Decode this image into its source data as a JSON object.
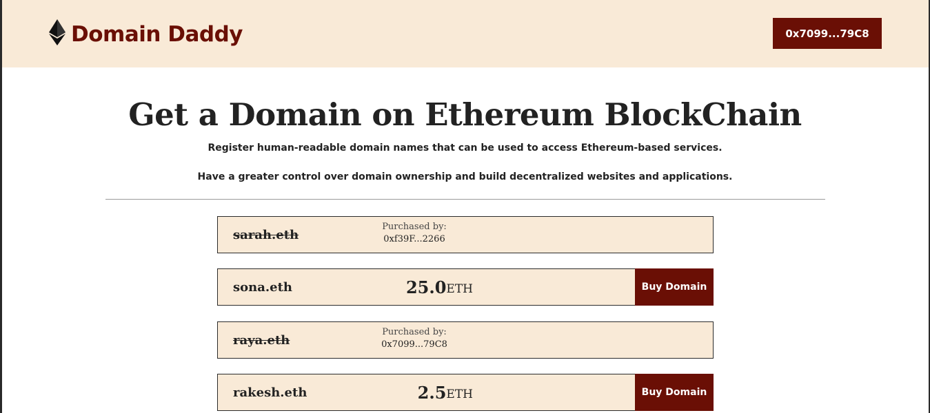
{
  "header": {
    "logo_text": "Domain Daddy",
    "logo_icon": "ethereum-icon",
    "wallet_address": "0x7099...79C8"
  },
  "hero": {
    "title": "Get a Domain on Ethereum BlockChain",
    "subtitle_1": "Register human-readable domain names that can be used to access Ethereum-based services.",
    "subtitle_2": "Have a greater control over domain ownership and build decentralized websites and applications."
  },
  "domains": [
    {
      "name": "sarah.eth",
      "status": "sold",
      "owner_label": "Purchased by:",
      "owner": "0xf39F...2266"
    },
    {
      "name": "sona.eth",
      "status": "available",
      "price": "25.0",
      "unit": "ETH",
      "buy_label": "Buy Domain"
    },
    {
      "name": "raya.eth",
      "status": "sold",
      "owner_label": "Purchased by:",
      "owner": "0x7099...79C8"
    },
    {
      "name": "rakesh.eth",
      "status": "available",
      "price": "2.5",
      "unit": "ETH",
      "buy_label": "Buy Domain"
    }
  ],
  "colors": {
    "brand": "#6a0f05",
    "header_bg": "#f9ead7",
    "card_bg": "#f9ead7"
  }
}
